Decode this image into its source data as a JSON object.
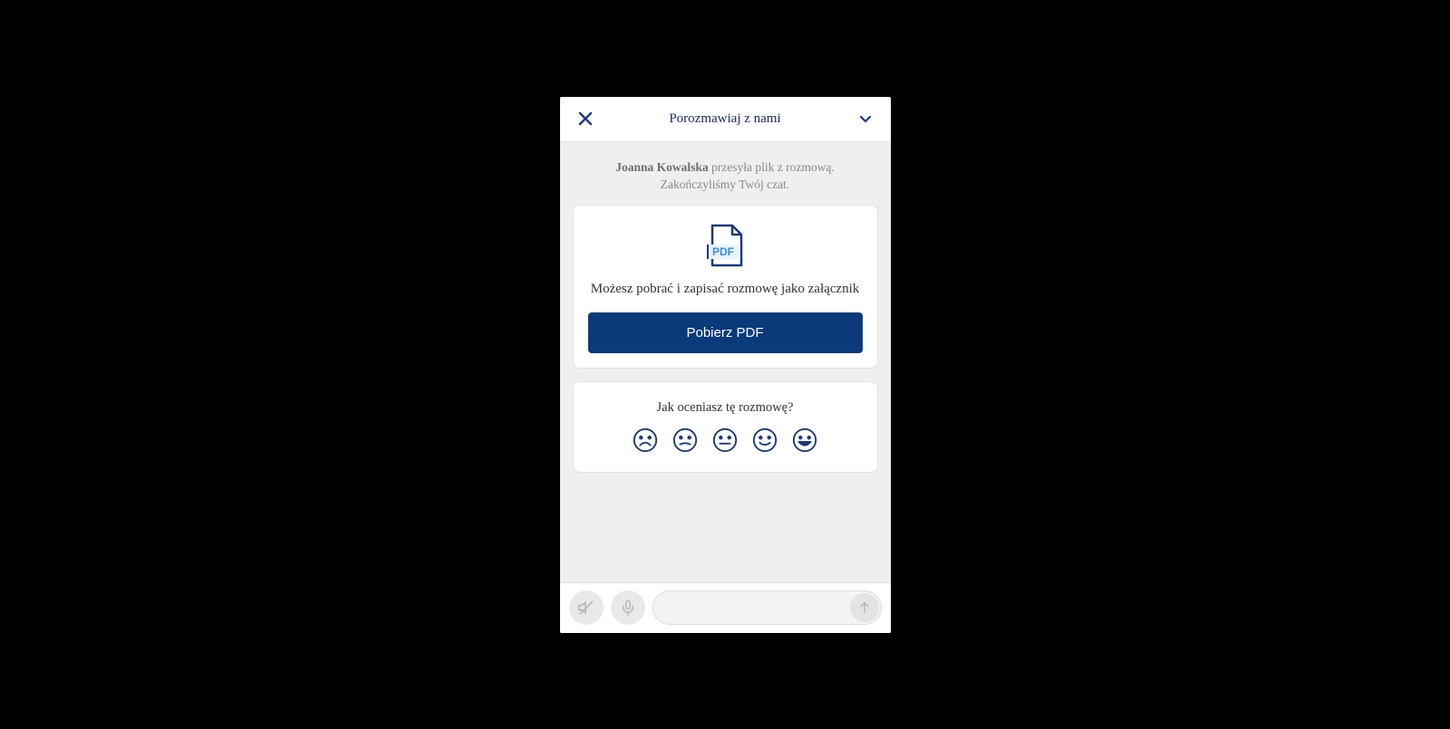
{
  "header": {
    "title": "Porozmawiaj z nami"
  },
  "status": {
    "agent_name": "Joanna Kowalska",
    "line1_suffix": " przesyła plik z rozmową.",
    "line2": "Zakończyliśmy Twój czat."
  },
  "download_card": {
    "pdf_badge": "PDF",
    "message": "Możesz pobrać i zapisać rozmowę jako załącznik",
    "button_label": "Pobierz PDF"
  },
  "rating_card": {
    "question": "Jak oceniasz tę rozmowę?"
  },
  "footer": {
    "input_placeholder": ""
  },
  "colors": {
    "primary": "#0a3a7a",
    "accent_text": "#1b3a7a"
  }
}
